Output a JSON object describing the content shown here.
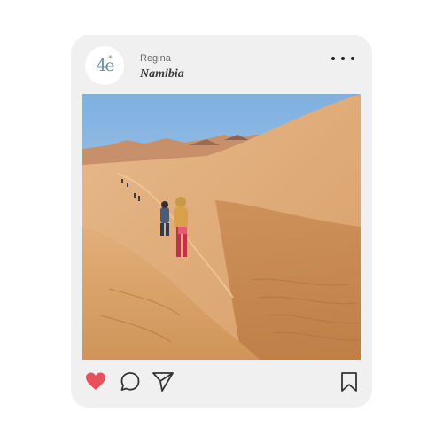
{
  "post": {
    "avatar_text": "4e",
    "avatar_sparkle": "✦",
    "username": "Regina",
    "location": "Namibia",
    "photo_alt": "Hikers walking along a sand dune ridge in the desert",
    "liked": true
  },
  "icons": {
    "more": "more-options-icon",
    "like": "heart-icon",
    "comment": "comment-icon",
    "share": "send-icon",
    "save": "bookmark-icon"
  },
  "colors": {
    "card_bg": "#f0f0f1",
    "like": "#e9505c",
    "icon_stroke": "#333333"
  }
}
